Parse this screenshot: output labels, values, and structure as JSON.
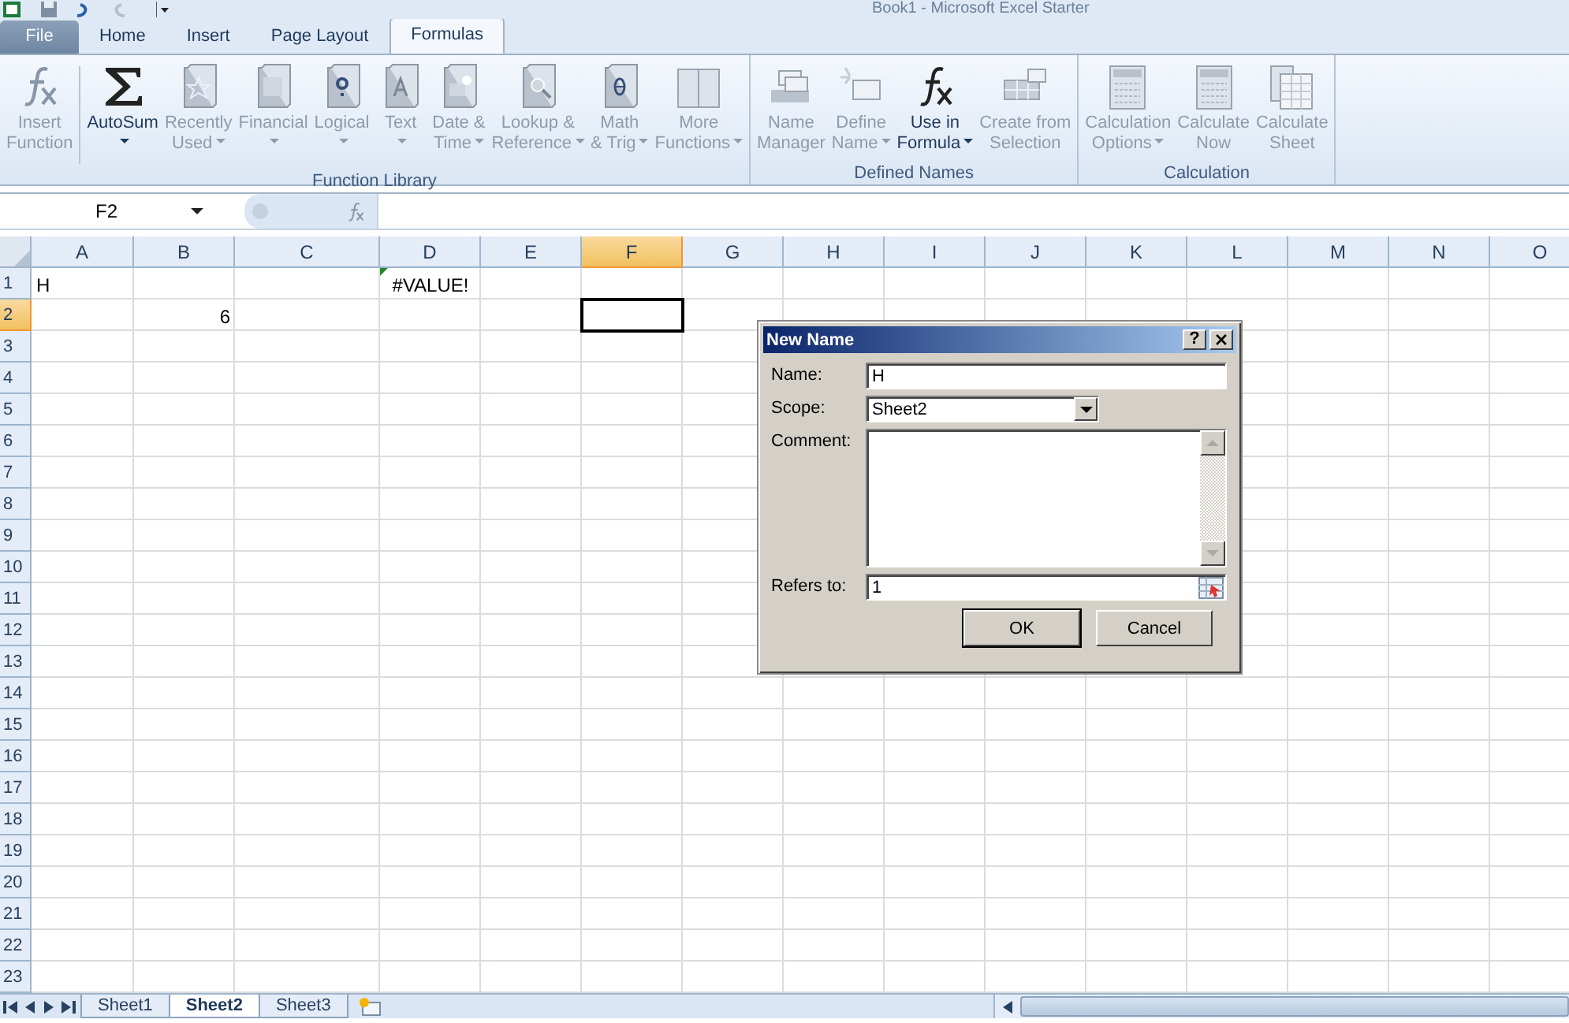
{
  "window": {
    "title": "Book1 - Microsoft Excel Starter"
  },
  "tabs": [
    {
      "label": "File",
      "kind": "file",
      "selected": false
    },
    {
      "label": "Home",
      "kind": "tab",
      "selected": false
    },
    {
      "label": "Insert",
      "kind": "tab",
      "selected": false
    },
    {
      "label": "Page Layout",
      "kind": "tab",
      "selected": false
    },
    {
      "label": "Formulas",
      "kind": "tab",
      "selected": true
    }
  ],
  "ribbon": {
    "groups": [
      {
        "label": "Function Library",
        "buttons": [
          {
            "lines": [
              "Insert",
              "Function"
            ],
            "dropdown": false,
            "disabled": true
          },
          {
            "lines": [
              "AutoSum"
            ],
            "dropdown": true,
            "disabled": false
          },
          {
            "lines": [
              "Recently",
              "Used"
            ],
            "dropdown": true,
            "disabled": true
          },
          {
            "lines": [
              "Financial"
            ],
            "dropdown": true,
            "disabled": true
          },
          {
            "lines": [
              "Logical"
            ],
            "dropdown": true,
            "disabled": true
          },
          {
            "lines": [
              "Text"
            ],
            "dropdown": true,
            "disabled": true
          },
          {
            "lines": [
              "Date &",
              "Time"
            ],
            "dropdown": true,
            "disabled": true
          },
          {
            "lines": [
              "Lookup &",
              "Reference"
            ],
            "dropdown": true,
            "disabled": true
          },
          {
            "lines": [
              "Math",
              "& Trig"
            ],
            "dropdown": true,
            "disabled": true
          },
          {
            "lines": [
              "More",
              "Functions"
            ],
            "dropdown": true,
            "disabled": true
          }
        ]
      },
      {
        "label": "Defined Names",
        "buttons": [
          {
            "lines": [
              "Name",
              "Manager"
            ],
            "dropdown": false,
            "disabled": true
          },
          {
            "lines": [
              "Define",
              "Name"
            ],
            "dropdown": true,
            "disabled": true
          },
          {
            "lines": [
              "Use in",
              "Formula"
            ],
            "dropdown": true,
            "disabled": false
          },
          {
            "lines": [
              "Create from",
              "Selection"
            ],
            "dropdown": false,
            "disabled": true
          }
        ]
      },
      {
        "label": "Calculation",
        "buttons": [
          {
            "lines": [
              "Calculation",
              "Options"
            ],
            "dropdown": true,
            "disabled": true
          },
          {
            "lines": [
              "Calculate",
              "Now"
            ],
            "dropdown": false,
            "disabled": true
          },
          {
            "lines": [
              "Calculate",
              "Sheet"
            ],
            "dropdown": false,
            "disabled": true
          }
        ]
      }
    ]
  },
  "formula_bar": {
    "name_box": "F2"
  },
  "sheet": {
    "columns": [
      {
        "label": "A",
        "selected": false
      },
      {
        "label": "B",
        "selected": false
      },
      {
        "label": "C",
        "selected": false
      },
      {
        "label": "D",
        "selected": false
      },
      {
        "label": "E",
        "selected": false
      },
      {
        "label": "F",
        "selected": true
      },
      {
        "label": "G",
        "selected": false
      },
      {
        "label": "H",
        "selected": false
      },
      {
        "label": "I",
        "selected": false
      },
      {
        "label": "J",
        "selected": false
      },
      {
        "label": "K",
        "selected": false
      },
      {
        "label": "L",
        "selected": false
      },
      {
        "label": "M",
        "selected": false
      },
      {
        "label": "N",
        "selected": false
      },
      {
        "label": "O",
        "selected": false
      }
    ],
    "rows": [
      {
        "label": "1",
        "selected": false,
        "cells": [
          {
            "kind": "text",
            "value": "H",
            "selected": false
          },
          {
            "selected": false
          },
          {
            "selected": false
          },
          {
            "kind": "error",
            "value": "#VALUE!",
            "error_flag": true,
            "selected": false
          }
        ]
      },
      {
        "label": "2",
        "selected": true,
        "cells": [
          {
            "selected": false
          },
          {
            "kind": "number",
            "value": "6",
            "selected": false
          },
          {
            "selected": false
          },
          {
            "selected": false
          },
          {
            "selected": false
          },
          {
            "selected": true
          }
        ]
      },
      {
        "label": "3",
        "selected": false
      },
      {
        "label": "4",
        "selected": false
      },
      {
        "label": "5",
        "selected": false
      },
      {
        "label": "6",
        "selected": false
      },
      {
        "label": "7",
        "selected": false
      },
      {
        "label": "8",
        "selected": false
      },
      {
        "label": "9",
        "selected": false
      },
      {
        "label": "10",
        "selected": false
      },
      {
        "label": "11",
        "selected": false
      },
      {
        "label": "12",
        "selected": false
      },
      {
        "label": "13",
        "selected": false
      },
      {
        "label": "14",
        "selected": false
      },
      {
        "label": "15",
        "selected": false
      },
      {
        "label": "16",
        "selected": false
      },
      {
        "label": "17",
        "selected": false
      },
      {
        "label": "18",
        "selected": false
      },
      {
        "label": "19",
        "selected": false
      },
      {
        "label": "20",
        "selected": false
      },
      {
        "label": "21",
        "selected": false
      },
      {
        "label": "22",
        "selected": false
      },
      {
        "label": "23",
        "selected": false
      }
    ]
  },
  "sheet_tabs": [
    {
      "label": "Sheet1",
      "selected": false
    },
    {
      "label": "Sheet2",
      "selected": true
    },
    {
      "label": "Sheet3",
      "selected": false
    }
  ],
  "dialog": {
    "title": "New Name",
    "help_glyph": "?",
    "fields": [
      {
        "label": "Name:",
        "kind": "text",
        "value": "H"
      },
      {
        "label": "Scope:",
        "kind": "dropdown",
        "value": "Sheet2"
      },
      {
        "label": "Comment:",
        "kind": "textarea"
      },
      {
        "label": "Refers to:",
        "kind": "range",
        "value": "1"
      }
    ],
    "buttons": [
      {
        "label": "OK",
        "default": true
      },
      {
        "label": "Cancel",
        "default": false
      }
    ]
  }
}
